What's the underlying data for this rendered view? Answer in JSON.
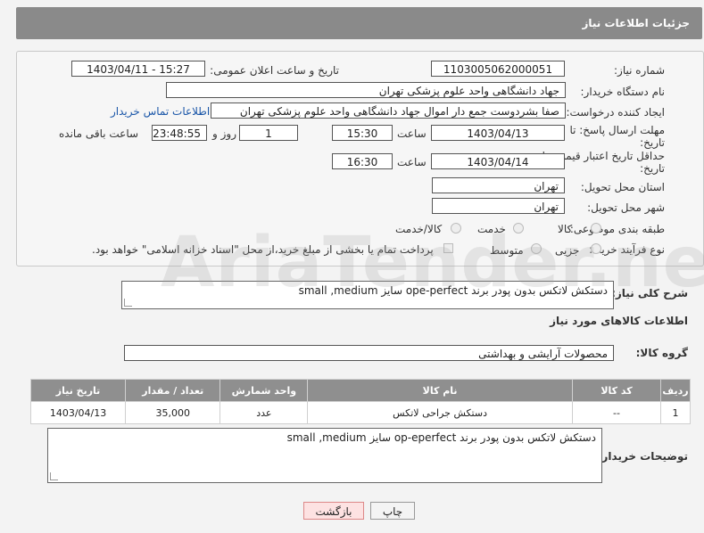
{
  "header": {
    "title": "جزئیات اطلاعات نیاز"
  },
  "fields": {
    "need_number_label": "شماره نیاز:",
    "need_number": "1103005062000051",
    "announce_label": "تاریخ و ساعت اعلان عمومی:",
    "announce_value": "1403/04/11 - 15:27",
    "buyer_org_label": "نام دستگاه خریدار:",
    "buyer_org": "جهاد دانشگاهی واحد علوم پزشکی تهران",
    "requester_label": "ایجاد کننده درخواست:",
    "requester": "صفا بشردوست جمع دار اموال  جهاد دانشگاهی واحد علوم پزشکی تهران",
    "contact_link": "اطلاعات تماس خریدار",
    "deadline_label_1": "مهلت ارسال پاسخ: تا",
    "deadline_label_2": "تاریخ:",
    "deadline_date": "1403/04/13",
    "time_label": "ساعت",
    "deadline_time": "15:30",
    "days_value": "1",
    "days_label": "روز و",
    "remaining_time": "23:48:55",
    "remaining_label": "ساعت باقی مانده",
    "price_valid_label_1": "حداقل تاریخ اعتبار قیمت: تا",
    "price_valid_label_2": "تاریخ:",
    "price_valid_date": "1403/04/14",
    "price_valid_time": "16:30",
    "province_label": "استان محل تحویل:",
    "province": "تهران",
    "city_label": "شهر محل تحویل:",
    "city": "تهران",
    "category_label": "طبقه بندی موضوعی:",
    "category_options": [
      "کالا",
      "خدمت",
      "کالا/خدمت"
    ],
    "purchase_type_label": "نوع فرآیند خرید :",
    "purchase_type_options": [
      "جزیی",
      "متوسط"
    ],
    "payment_note": "پرداخت تمام یا بخشی از مبلغ خرید،از محل \"اسناد خزانه اسلامی\" خواهد بود."
  },
  "description": {
    "label": "شرح کلی نیاز:",
    "value": "دستکش لاتکس بدون پودر برند ope-perfect   سایز small ,medium"
  },
  "goods_info_title": "اطلاعات کالاهای مورد نیاز",
  "goods_group": {
    "label": "گروه کالا:",
    "value": "محصولات آرایشی و بهداشتی"
  },
  "table": {
    "headers": [
      "ردیف",
      "کد کالا",
      "نام کالا",
      "واحد شمارش",
      "تعداد / مقدار",
      "تاریخ نیاز"
    ],
    "rows": [
      [
        "1",
        "--",
        "دستکش جراحی لاتکس",
        "عدد",
        "35,000",
        "1403/04/13"
      ]
    ]
  },
  "buyer_notes": {
    "label": "توضیحات خریدار:",
    "value": "دستکش لاتکس بدون پودر برند op-eperfect  سایز small ,medium"
  },
  "buttons": {
    "print": "چاپ",
    "back": "بازگشت"
  },
  "watermark": "AriaTender.net"
}
